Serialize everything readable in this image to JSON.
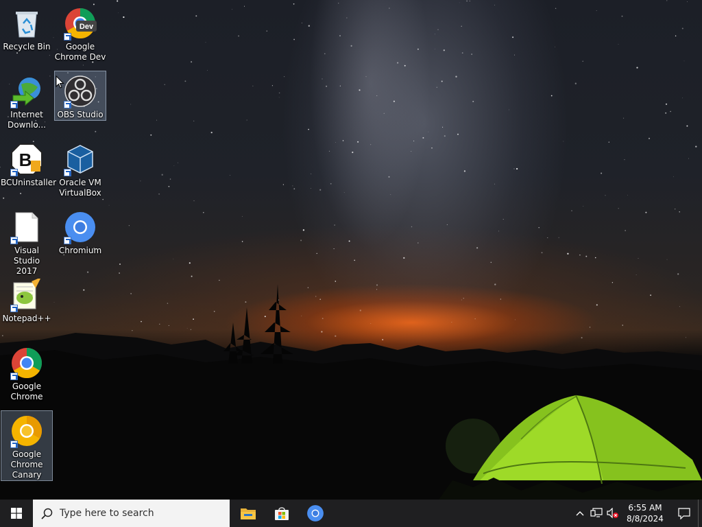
{
  "desktop_icons": [
    {
      "label": "Recycle Bin",
      "icon": "recycle-bin-icon",
      "shortcut": false
    },
    {
      "label": "Google\nChrome Dev",
      "icon": "chrome-dev-icon",
      "shortcut": true
    },
    {
      "label": "Internet\nDownlo...",
      "icon": "internet-download-manager-icon",
      "shortcut": true
    },
    {
      "label": "OBS Studio",
      "icon": "obs-studio-icon",
      "shortcut": true
    },
    {
      "label": "BCUninstaller",
      "icon": "bcuninstaller-icon",
      "shortcut": true
    },
    {
      "label": "Oracle VM\nVirtualBox",
      "icon": "virtualbox-icon",
      "shortcut": true
    },
    {
      "label": "Visual Studio\n2017",
      "icon": "visual-studio-icon",
      "shortcut": true
    },
    {
      "label": "Chromium",
      "icon": "chromium-icon",
      "shortcut": true
    },
    {
      "label": "Notepad++",
      "icon": "notepad-plus-plus-icon",
      "shortcut": true
    },
    {
      "label": "Google\nChrome",
      "icon": "chrome-icon",
      "shortcut": true
    },
    {
      "label": "Google\nChrome\nCanary",
      "icon": "chrome-canary-icon",
      "shortcut": true
    }
  ],
  "chrome_dev_badge": "Dev",
  "taskbar": {
    "search_placeholder": "Type here to search",
    "pinned_apps": [
      "file-explorer-icon",
      "microsoft-store-icon",
      "chromium-icon"
    ],
    "clock_time": "6:55 AM",
    "clock_date": "8/8/2024",
    "tray_icons": [
      "chevron-up-icon",
      "network-icon",
      "volume-muted-icon"
    ]
  },
  "colors": {
    "taskbar_bg": "#1f1f21",
    "search_bg": "#f3f3f3",
    "selection": "#96aac8"
  }
}
